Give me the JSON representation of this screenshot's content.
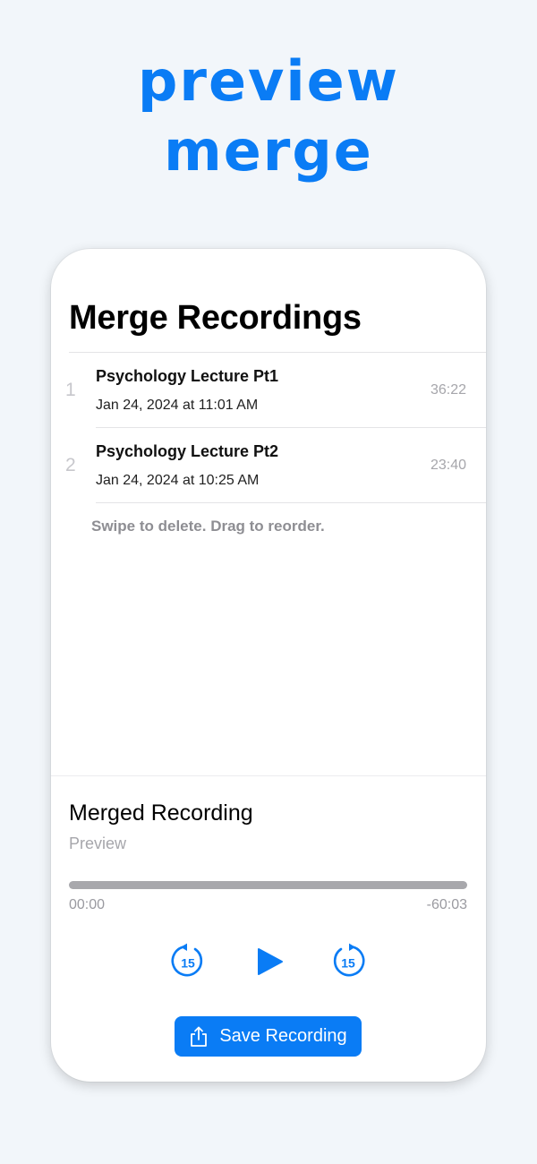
{
  "headline": {
    "line1": "preview",
    "line2": "merge"
  },
  "screen": {
    "title": "Merge Recordings"
  },
  "recordings": [
    {
      "index": "1",
      "name": "Psychology Lecture Pt1",
      "date": "Jan 24, 2024 at 11:01 AM",
      "duration": "36:22"
    },
    {
      "index": "2",
      "name": "Psychology Lecture Pt2",
      "date": "Jan 24, 2024 at 10:25 AM",
      "duration": "23:40"
    }
  ],
  "hint": "Swipe to delete. Drag to reorder.",
  "merged": {
    "title": "Merged Recording",
    "subtitle": "Preview",
    "progress_fraction": 0,
    "time_elapsed": "00:00",
    "time_remaining": "-60:03"
  },
  "controls": {
    "skip_back_seconds": "15",
    "skip_forward_seconds": "15",
    "back_icon": "rewind-15-icon",
    "play_icon": "play-icon",
    "forward_icon": "forward-15-icon"
  },
  "save_button": {
    "label": "Save Recording",
    "icon": "share-icon"
  },
  "colors": {
    "accent": "#0A7CF5",
    "background": "#F2F6FA",
    "secondary_text": "#8E8E93",
    "track": "#A8A8AC"
  }
}
